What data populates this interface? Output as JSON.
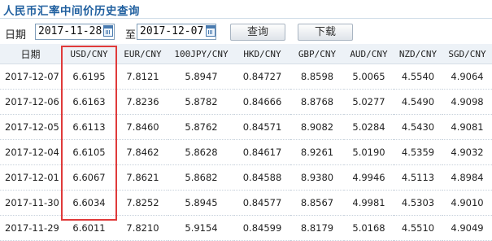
{
  "page": {
    "title": "人民币汇率中间价历史查询"
  },
  "filter": {
    "date_label": "日期",
    "start_date": "2017-11-28",
    "to_label": "至",
    "end_date": "2017-12-07",
    "query_button": "查询",
    "download_button": "下载"
  },
  "table": {
    "headers": [
      "日期",
      "USD/CNY",
      "EUR/CNY",
      "100JPY/CNY",
      "HKD/CNY",
      "GBP/CNY",
      "AUD/CNY",
      "NZD/CNY",
      "SGD/CNY"
    ],
    "rows": [
      [
        "2017-12-07",
        "6.6195",
        "7.8121",
        "5.8947",
        "0.84727",
        "8.8598",
        "5.0065",
        "4.5540",
        "4.9064"
      ],
      [
        "2017-12-06",
        "6.6163",
        "7.8236",
        "5.8782",
        "0.84666",
        "8.8768",
        "5.0277",
        "4.5490",
        "4.9098"
      ],
      [
        "2017-12-05",
        "6.6113",
        "7.8460",
        "5.8762",
        "0.84571",
        "8.9082",
        "5.0284",
        "4.5430",
        "4.9081"
      ],
      [
        "2017-12-04",
        "6.6105",
        "7.8462",
        "5.8628",
        "0.84617",
        "8.9261",
        "5.0190",
        "4.5359",
        "4.9032"
      ],
      [
        "2017-12-01",
        "6.6067",
        "7.8621",
        "5.8682",
        "0.84588",
        "8.9380",
        "4.9946",
        "4.5113",
        "4.8984"
      ],
      [
        "2017-11-30",
        "6.6034",
        "7.8252",
        "5.8945",
        "0.84577",
        "8.8567",
        "4.9981",
        "4.5303",
        "4.9010"
      ],
      [
        "2017-11-29",
        "6.6011",
        "7.8210",
        "5.9154",
        "0.84599",
        "8.8179",
        "5.0168",
        "4.5510",
        "4.9049"
      ]
    ]
  },
  "colors": {
    "title": "#1f5f9f",
    "highlight_border": "#e03a3a",
    "header_bg": "#edf2f7"
  }
}
